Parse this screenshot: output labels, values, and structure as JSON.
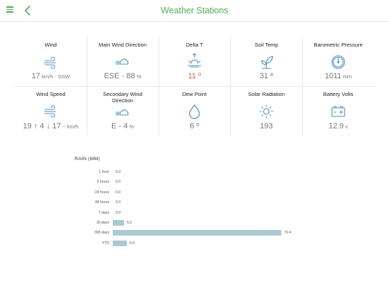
{
  "header": {
    "title": "Weather Stations"
  },
  "stations": [
    {
      "label": "Wind",
      "icon": "wind-icon",
      "value_main": "17",
      "value_unit": " km/h - SSW",
      "value_color": "#777777"
    },
    {
      "label": "Main Wind Direction",
      "icon": "wind-direction-icon",
      "value_main": "ESE - 88",
      "value_unit": " %",
      "value_color": "#777777"
    },
    {
      "label": "Delta T",
      "icon": "sunrise-icon",
      "value_main": "11 º",
      "value_unit": "",
      "value_color": "#e05a4f"
    },
    {
      "label": "Soil Temp",
      "icon": "sprout-icon",
      "value_main": "31 º",
      "value_unit": "",
      "value_color": "#777777"
    },
    {
      "label": "Barometric Pressure",
      "icon": "barometer-icon",
      "value_main": "1011",
      "value_unit": " mm",
      "value_color": "#777777"
    },
    {
      "label": "Wind Speed",
      "icon": "wind-icon",
      "value_main": "19 ↑ 4 ↓ 17",
      "value_unit": " ~ km/h",
      "value_color": "#777777"
    },
    {
      "label": "Secondary Wind Direction",
      "icon": "wind-direction-icon",
      "value_main": "E - 4",
      "value_unit": " %",
      "value_color": "#777777"
    },
    {
      "label": "Dew Point",
      "icon": "water-drop-icon",
      "value_main": "6 º",
      "value_unit": "",
      "value_color": "#777777"
    },
    {
      "label": "Solar Radiation",
      "icon": "sun-icon",
      "value_main": "193",
      "value_unit": "",
      "value_color": "#777777"
    },
    {
      "label": "Battery Volts",
      "icon": "battery-icon",
      "value_main": "12.9",
      "value_unit": " v",
      "value_color": "#777777"
    }
  ],
  "rain": {
    "title": "RAIN (MM)",
    "bar_color": "#a9c9d3"
  },
  "chart_data": {
    "type": "bar",
    "orientation": "horizontal",
    "title": "RAIN (MM)",
    "categories": [
      "1 hour",
      "6 hours",
      "24 hours",
      "48 hours",
      "7 days",
      "30 days",
      "365 days",
      "YTD"
    ],
    "values": [
      0.0,
      0.0,
      0.0,
      0.0,
      0.0,
      5.2,
      79.4,
      6.6
    ],
    "value_labels": [
      "0.0",
      "0.0",
      "0.0",
      "0.0",
      "0.0",
      "5.2",
      "79.4",
      "6.6"
    ],
    "xlim": [
      0,
      79.4
    ],
    "grid": false
  }
}
